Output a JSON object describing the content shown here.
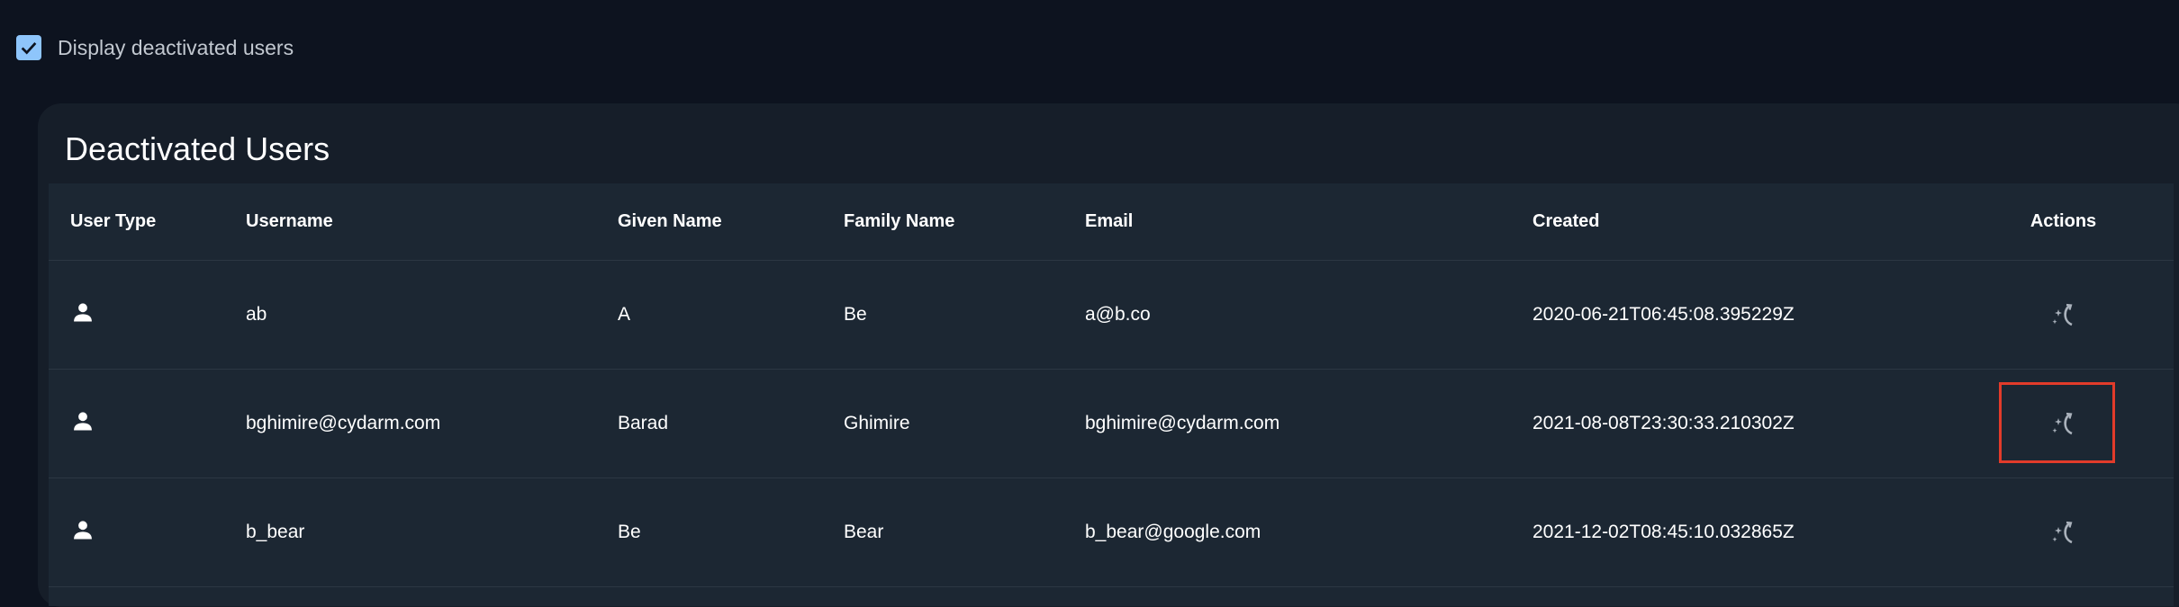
{
  "filter": {
    "checkbox_label": "Display deactivated users",
    "checked": true
  },
  "card": {
    "title": "Deactivated Users"
  },
  "table": {
    "columns": [
      "User Type",
      "Username",
      "Given Name",
      "Family Name",
      "Email",
      "Created",
      "Actions"
    ],
    "rows": [
      {
        "user_type_icon": "person-icon",
        "username": "ab",
        "given_name": "A",
        "family_name": "Be",
        "email": "a@b.co",
        "created": "2020-06-21T06:45:08.395229Z",
        "action_icon": "reactivate-icon"
      },
      {
        "user_type_icon": "person-icon",
        "username": "bghimire@cydarm.com",
        "given_name": "Barad",
        "family_name": "Ghimire",
        "email": "bghimire@cydarm.com",
        "created": "2021-08-08T23:30:33.210302Z",
        "action_icon": "reactivate-icon"
      },
      {
        "user_type_icon": "person-icon",
        "username": "b_bear",
        "given_name": "Be",
        "family_name": "Bear",
        "email": "b_bear@google.com",
        "created": "2021-12-02T08:45:10.032865Z",
        "action_icon": "reactivate-icon"
      }
    ]
  },
  "colors": {
    "background": "#0d131f",
    "card": "#161e29",
    "table": "#1c2733",
    "checkbox": "#8ec5fb",
    "highlight": "#e23b2a"
  }
}
